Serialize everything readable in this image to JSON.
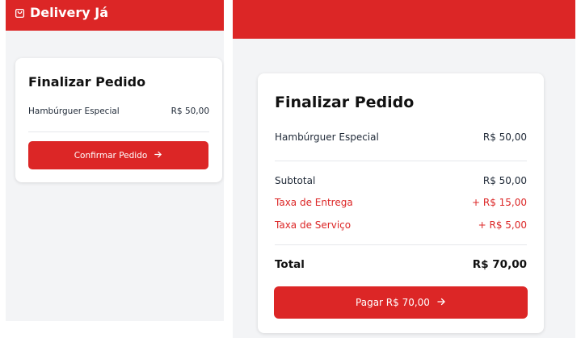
{
  "app": {
    "brand": "Delivery Já"
  },
  "colors": {
    "primary": "#dc2626",
    "background": "#f3f4f6",
    "card": "#ffffff"
  },
  "left_view": {
    "title": "Finalizar Pedido",
    "items": [
      {
        "name": "Hambúrguer Especial",
        "price": "R$ 50,00"
      }
    ],
    "confirm_button": {
      "label": "Confirmar Pedido",
      "icon": "arrow-right-icon"
    }
  },
  "right_view": {
    "title": "Finalizar Pedido",
    "items": [
      {
        "name": "Hambúrguer Especial",
        "price": "R$ 50,00"
      }
    ],
    "summary": {
      "subtotal": {
        "label": "Subtotal",
        "value": "R$ 50,00"
      },
      "delivery_fee": {
        "label": "Taxa de Entrega",
        "value": "+ R$ 15,00"
      },
      "service_fee": {
        "label": "Taxa de Serviço",
        "value": "+ R$ 5,00"
      },
      "total": {
        "label": "Total",
        "value": "R$ 70,00"
      }
    },
    "pay_button": {
      "label": "Pagar R$ 70,00",
      "icon": "arrow-right-icon"
    }
  }
}
